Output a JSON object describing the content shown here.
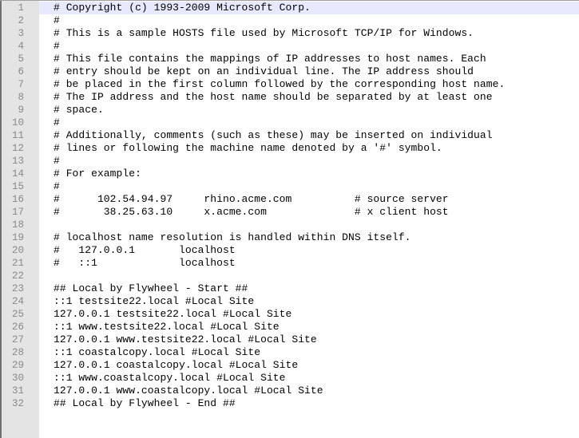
{
  "editor": {
    "current_line": 1,
    "colors": {
      "current_line_bg": "#e8e8ff",
      "gutter_bg": "#e4e4e4",
      "line_number": "#8a8a8a",
      "text": "#000000"
    },
    "lines": [
      "# Copyright (c) 1993-2009 Microsoft Corp.",
      "#",
      "# This is a sample HOSTS file used by Microsoft TCP/IP for Windows.",
      "#",
      "# This file contains the mappings of IP addresses to host names. Each",
      "# entry should be kept on an individual line. The IP address should",
      "# be placed in the first column followed by the corresponding host name.",
      "# The IP address and the host name should be separated by at least one",
      "# space.",
      "#",
      "# Additionally, comments (such as these) may be inserted on individual",
      "# lines or following the machine name denoted by a '#' symbol.",
      "#",
      "# For example:",
      "#",
      "#      102.54.94.97     rhino.acme.com          # source server",
      "#       38.25.63.10     x.acme.com              # x client host",
      "",
      "# localhost name resolution is handled within DNS itself.",
      "#   127.0.0.1       localhost",
      "#   ::1             localhost",
      "",
      "## Local by Flywheel - Start ##",
      "::1 testsite22.local #Local Site",
      "127.0.0.1 testsite22.local #Local Site",
      "::1 www.testsite22.local #Local Site",
      "127.0.0.1 www.testsite22.local #Local Site",
      "::1 coastalcopy.local #Local Site",
      "127.0.0.1 coastalcopy.local #Local Site",
      "::1 www.coastalcopy.local #Local Site",
      "127.0.0.1 www.coastalcopy.local #Local Site",
      "## Local by Flywheel - End ##"
    ]
  }
}
